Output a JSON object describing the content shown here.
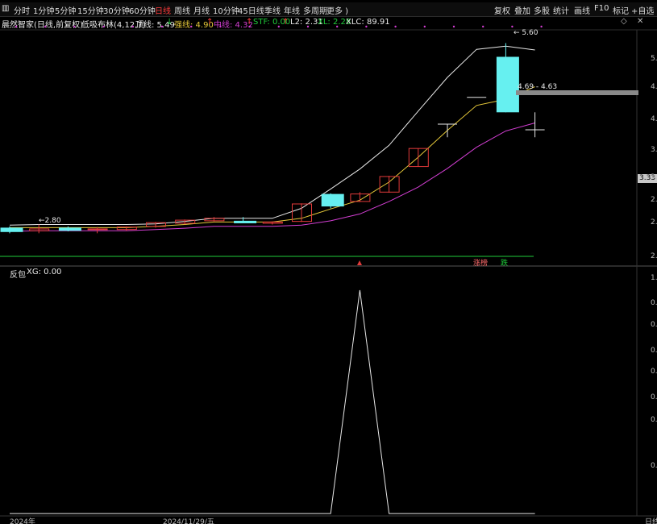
{
  "toolbar": {
    "left_icon": "layout-icon",
    "periods": [
      "分时",
      "1分钟",
      "5分钟",
      "15分钟",
      "30分钟",
      "60分钟",
      "日线",
      "周线",
      "月线",
      "10分钟",
      "45日线",
      "季线",
      "年线",
      "多周期",
      "更多 )"
    ],
    "active_period": "日线",
    "actions": [
      "复权",
      "叠加",
      "多股",
      "统计",
      "画线",
      "F10",
      "标记",
      "+自选"
    ]
  },
  "main_info": {
    "stock": "晨然智家(日线,前复权)",
    "indicator": "低吸布林(4,12,7)",
    "top_label": "顶线: 5.49",
    "top_arrow": "↓",
    "strong_label": "强线: 4.90",
    "strong_arrow": "↑",
    "mid_label": "中线: 4.32",
    "mid_arrow": "↑",
    "stf_label": "STF: 0.00",
    "stf_arrow": "↑",
    "l2_label": "L2: 2.31",
    "xl_label": "XL: 2.28",
    "xlc_label": "XLC: 89.91",
    "arrow_down": "↓",
    "colors": {
      "top": "#e8e8e8",
      "strong": "#e6c93a",
      "mid": "#d23ed2",
      "stf": "#1fcc3a",
      "l2": "#e8e8e8",
      "xl": "#1fcc3a",
      "xlc": "#e8e8e8"
    }
  },
  "main_chart": {
    "high_label": "5.60",
    "low_label": "2.80",
    "range_label": "4.69 - 4.63",
    "current_price": "3.33",
    "y_ticks": [
      "5.",
      "4.",
      "4.",
      "3.",
      "3.",
      "2.",
      "2.",
      "2."
    ],
    "signal_zhangting": "涨榜",
    "signal_die": "跌",
    "candles": [
      {
        "o": 2.57,
        "h": 2.66,
        "l": 2.55,
        "c": 2.64,
        "color": "cyan"
      },
      {
        "o": 2.62,
        "h": 2.69,
        "l": 2.55,
        "c": 2.59,
        "color": "red"
      },
      {
        "o": 2.59,
        "h": 2.66,
        "l": 2.58,
        "c": 2.64,
        "color": "cyan"
      },
      {
        "o": 2.62,
        "h": 2.65,
        "l": 2.55,
        "c": 2.61,
        "color": "red"
      },
      {
        "o": 2.61,
        "h": 2.66,
        "l": 2.59,
        "c": 2.65,
        "color": "red"
      },
      {
        "o": 2.66,
        "h": 2.73,
        "l": 2.64,
        "c": 2.72,
        "color": "red"
      },
      {
        "o": 2.71,
        "h": 2.77,
        "l": 2.69,
        "c": 2.76,
        "color": "red"
      },
      {
        "o": 2.75,
        "h": 2.81,
        "l": 2.74,
        "c": 2.79,
        "color": "red"
      },
      {
        "o": 2.75,
        "h": 2.81,
        "l": 2.72,
        "c": 2.71,
        "color": "cyan"
      },
      {
        "o": 2.71,
        "h": 2.74,
        "l": 2.69,
        "c": 2.73,
        "color": "red"
      },
      {
        "o": 2.74,
        "h": 3.03,
        "l": 2.73,
        "c": 3.02,
        "color": "red"
      },
      {
        "o": 3.18,
        "h": 3.19,
        "l": 2.95,
        "c": 2.98,
        "color": "cyan"
      },
      {
        "o": 3.06,
        "h": 3.21,
        "l": 3.05,
        "c": 3.18,
        "color": "red"
      },
      {
        "o": 3.21,
        "h": 3.47,
        "l": 3.2,
        "c": 3.46,
        "color": "red"
      },
      {
        "o": 3.62,
        "h": 3.91,
        "l": 3.62,
        "c": 3.91,
        "color": "red"
      },
      {
        "o": 4.3,
        "h": 4.3,
        "l": 4.09,
        "c": 4.3,
        "color": "white"
      },
      {
        "o": 4.73,
        "h": 4.73,
        "l": 4.73,
        "c": 4.73,
        "color": "white"
      },
      {
        "o": 5.38,
        "h": 5.6,
        "l": 4.49,
        "c": 4.49,
        "color": "cyan"
      },
      {
        "o": 4.21,
        "h": 4.49,
        "l": 4.09,
        "c": 4.21,
        "color": "white"
      }
    ],
    "top_line": [
      2.68,
      2.69,
      2.69,
      2.69,
      2.69,
      2.7,
      2.74,
      2.79,
      2.79,
      2.79,
      2.95,
      3.26,
      3.58,
      3.96,
      4.51,
      5.05,
      5.5,
      5.55,
      5.49
    ],
    "strong_line": [
      2.64,
      2.64,
      2.64,
      2.64,
      2.64,
      2.66,
      2.69,
      2.73,
      2.73,
      2.73,
      2.79,
      2.94,
      3.08,
      3.37,
      3.77,
      4.2,
      4.6,
      4.7,
      4.9
    ],
    "mid_line": [
      2.58,
      2.59,
      2.59,
      2.59,
      2.59,
      2.61,
      2.63,
      2.66,
      2.66,
      2.66,
      2.68,
      2.75,
      2.86,
      3.06,
      3.29,
      3.59,
      3.93,
      4.19,
      4.32
    ],
    "y_range": [
      2.05,
      5.8
    ]
  },
  "sub_info": {
    "name": "反包",
    "xg_label": "XG: 0.00"
  },
  "sub_chart": {
    "xg_values": [
      0,
      0,
      0,
      0,
      0,
      0,
      0,
      0,
      0,
      0,
      0,
      0,
      1,
      0,
      0,
      0,
      0,
      0,
      0
    ],
    "y_ticks": [
      "1.",
      "0.",
      "0.",
      "0.",
      "0.",
      "0.",
      "0.",
      "0."
    ],
    "y_range": [
      0,
      1.05
    ]
  },
  "bottom_axis": {
    "year_label": "2024年",
    "date_label": "2024/11/29/五",
    "right_label": "日线"
  },
  "controls": {
    "diamond": "diamond-icon",
    "close": "close-icon"
  }
}
